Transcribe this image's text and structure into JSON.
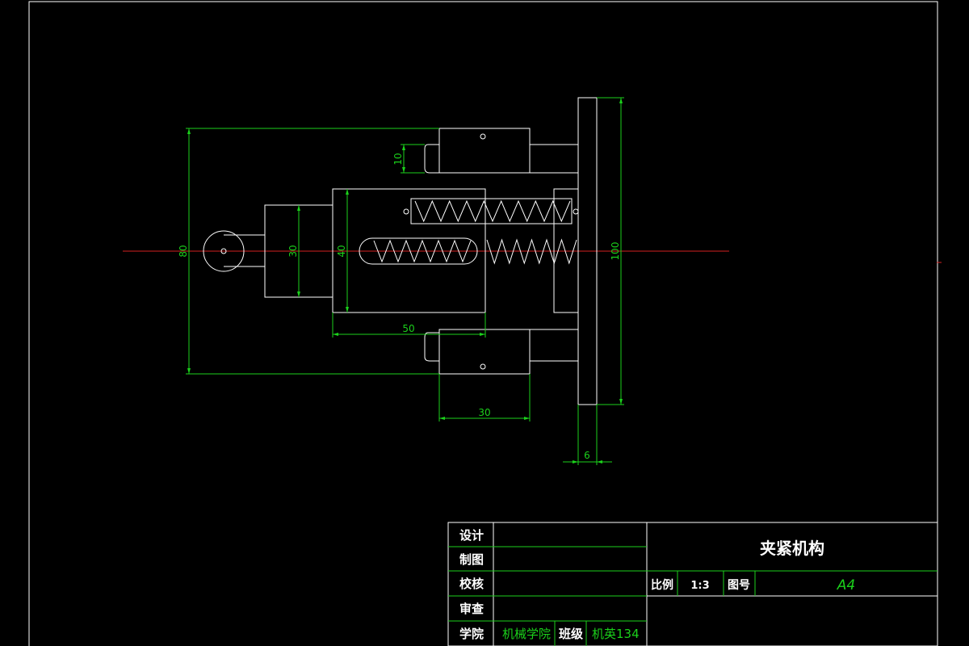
{
  "drawing": {
    "dimensions": {
      "d10": "10",
      "d80": "80",
      "d30_vertical": "30",
      "d40": "40",
      "d50": "50",
      "d30_horizontal": "30",
      "d100": "100",
      "d6": "6"
    }
  },
  "title_block": {
    "rows": [
      {
        "label": "设计",
        "value": ""
      },
      {
        "label": "制图",
        "value": ""
      },
      {
        "label": "校核",
        "value": ""
      },
      {
        "label": "审查",
        "value": ""
      }
    ],
    "college_label": "学院",
    "college_value": "机械学院",
    "class_label": "班级",
    "class_value": "机英134",
    "title": "夹紧机构",
    "scale_label": "比例",
    "scale_value": "1:3",
    "drawing_no_label": "图号",
    "drawing_no_value": "A4"
  },
  "colors": {
    "outline": "#ffffff",
    "dimension": "#1bd11b",
    "centerline": "#d42020",
    "background": "#000000"
  }
}
